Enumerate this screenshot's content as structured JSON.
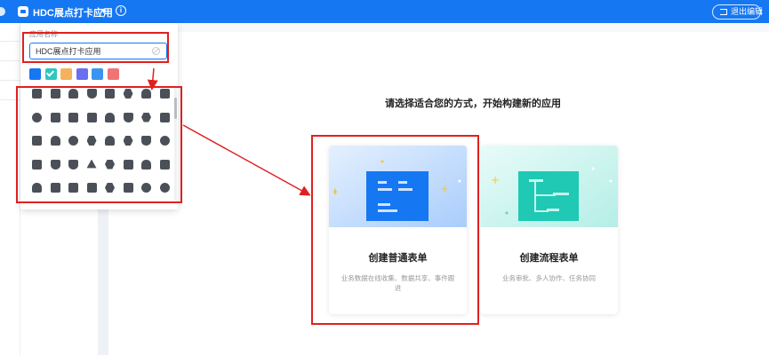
{
  "topbar": {
    "app_name": "HDC展点打卡应用",
    "caret": "▼",
    "info_glyph": "i",
    "exit_label": "退出编辑"
  },
  "popup": {
    "field_label": "应用名称",
    "name_value": "HDC展点打卡应用",
    "colors": [
      {
        "name": "blue",
        "hex": "#1677f2",
        "selected": false
      },
      {
        "name": "teal",
        "hex": "#2ec7c0",
        "selected": true
      },
      {
        "name": "orange",
        "hex": "#f5b25c",
        "selected": false
      },
      {
        "name": "indigo",
        "hex": "#6b6ef0",
        "selected": false
      },
      {
        "name": "sky",
        "hex": "#3b95f0",
        "selected": false
      },
      {
        "name": "coral",
        "hex": "#f07474",
        "selected": false
      }
    ],
    "icons": [
      "calendar-icon",
      "edit-icon",
      "people-icon",
      "house-icon",
      "folder-icon",
      "tools-icon",
      "chat-icon",
      "archive-icon",
      "globe-icon",
      "briefcase-icon",
      "qr-icon",
      "document-icon",
      "card-icon",
      "shield-icon",
      "gear-icon",
      "api-icon",
      "pulse-icon",
      "cloud-icon",
      "eye-icon",
      "cube-icon",
      "cloud-download-icon",
      "hexagon-icon",
      "house-shield-icon",
      "bulb-icon",
      "battery-icon",
      "flag-icon",
      "bookmark-icon",
      "warning-icon",
      "bug-icon",
      "briefcase-icon",
      "chat-icon",
      "monitor-icon",
      "cloud-upload-icon",
      "notes-icon",
      "frame-icon",
      "file-icon",
      "badge-icon",
      "list-icon",
      "close-circle-icon",
      "swap-icon"
    ],
    "icon_shapes": [
      0,
      0,
      5,
      2,
      0,
      4,
      5,
      0,
      1,
      0,
      0,
      0,
      5,
      2,
      4,
      0,
      0,
      5,
      1,
      4,
      5,
      4,
      2,
      1,
      0,
      2,
      2,
      3,
      4,
      0,
      5,
      0,
      5,
      0,
      0,
      0,
      4,
      0,
      1,
      1
    ]
  },
  "main": {
    "heading": "请选择适合您的方式，开始构建新的应用",
    "cards": [
      {
        "title": "创建普通表单",
        "desc": "业务数据在线收集、数据共享、事件跟进"
      },
      {
        "title": "创建流程表单",
        "desc": "业务审批、多人协作、任务协同"
      }
    ]
  },
  "colors": {
    "brand": "#1677f2",
    "annotation_red": "#e02020"
  }
}
